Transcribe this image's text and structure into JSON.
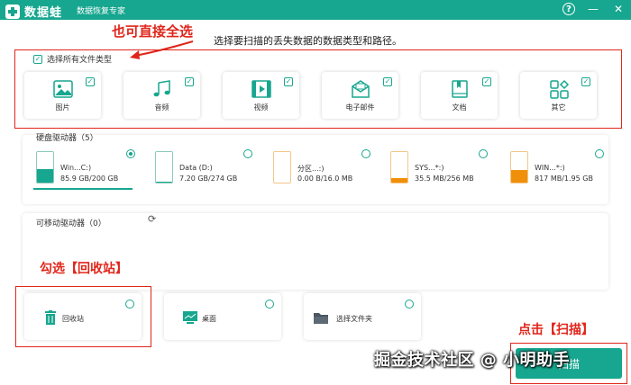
{
  "app": {
    "name": "数据蛙",
    "subtitle": "数据恢复专家"
  },
  "window_controls": {
    "help": "?",
    "minimize": "—",
    "close": "✕"
  },
  "annotations": {
    "select_all_hint": "也可直接全选",
    "recycle_hint": "勾选【回收站】",
    "scan_hint": "点击【扫描】"
  },
  "instruction": "选择要扫描的丢失数据的数据类型和路径。",
  "file_types": {
    "select_all_label": "选择所有文件类型",
    "select_all_checked": true,
    "items": [
      {
        "label": "图片",
        "icon": "image-icon",
        "checked": true
      },
      {
        "label": "音频",
        "icon": "audio-icon",
        "checked": true
      },
      {
        "label": "视频",
        "icon": "video-icon",
        "checked": true
      },
      {
        "label": "电子邮件",
        "icon": "email-icon",
        "checked": true
      },
      {
        "label": "文档",
        "icon": "document-icon",
        "checked": true
      },
      {
        "label": "其它",
        "icon": "other-icon",
        "checked": true
      }
    ]
  },
  "hard_drives": {
    "title": "硬盘驱动器（5）",
    "items": [
      {
        "name": "Win...C:)",
        "size": "85.9 GB/200 GB",
        "fill": 0.43,
        "color": "#17a68f",
        "selected": true
      },
      {
        "name": "Data (D:)",
        "size": "7.20 GB/274 GB",
        "fill": 0.03,
        "color": "#17a68f",
        "selected": false
      },
      {
        "name": "分区...:)",
        "size": "0.00  B/16.0 MB",
        "fill": 0.0,
        "color": "#f0900a",
        "selected": false
      },
      {
        "name": "SYS...*:)",
        "size": "35.5 MB/256 MB",
        "fill": 0.14,
        "color": "#f0900a",
        "selected": false
      },
      {
        "name": "WIN...*:)",
        "size": "817 MB/1.95 GB",
        "fill": 0.42,
        "color": "#f0900a",
        "selected": false
      }
    ]
  },
  "removable": {
    "title": "可移动驱动器（0）",
    "refresh_icon": "refresh-icon"
  },
  "locations": [
    {
      "label": "回收站",
      "icon": "trash-icon"
    },
    {
      "label": "桌面",
      "icon": "desktop-icon"
    },
    {
      "label": "选择文件夹",
      "icon": "folder-icon"
    }
  ],
  "scan_button": {
    "label": "扫描"
  },
  "watermark": "掘金技术社区 @ 小明助手",
  "colors": {
    "brand": "#17a68f",
    "annotation": "#e0261b",
    "warning": "#f0900a"
  }
}
